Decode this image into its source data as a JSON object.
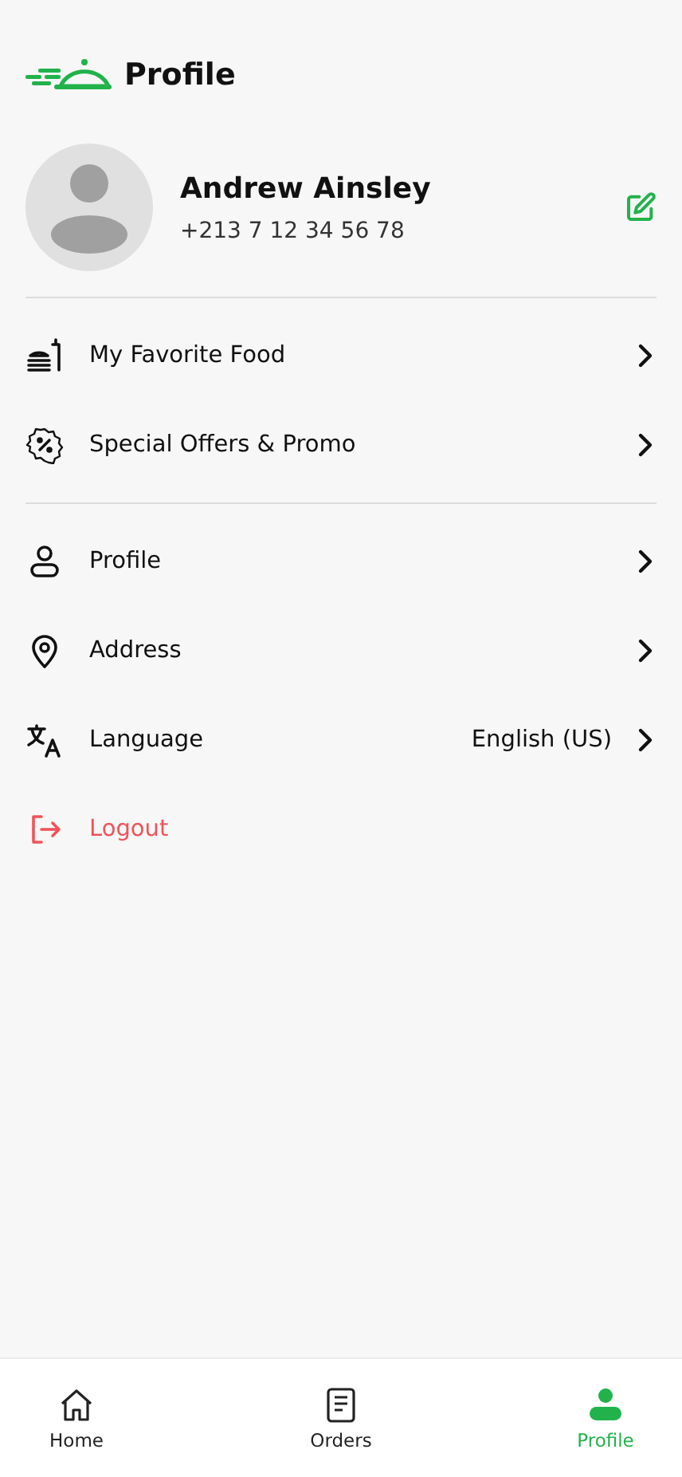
{
  "header": {
    "title": "Profile"
  },
  "user": {
    "name": "Andrew Ainsley",
    "phone": "+213 7 12 34 56 78"
  },
  "menu_sections": [
    {
      "items": [
        {
          "kind": "food",
          "label": "My Favorite Food"
        },
        {
          "kind": "promo",
          "label": "Special Offers & Promo"
        }
      ]
    },
    {
      "items": [
        {
          "kind": "person",
          "label": "Profile"
        },
        {
          "kind": "pin",
          "label": "Address"
        },
        {
          "kind": "translate",
          "label": "Language",
          "value": "English (US)"
        },
        {
          "kind": "logout",
          "label": "Logout"
        }
      ]
    }
  ],
  "bottom_nav": [
    {
      "kind": "home",
      "label": "Home",
      "selected": false
    },
    {
      "kind": "orders",
      "label": "Orders",
      "selected": false
    },
    {
      "kind": "person",
      "label": "Profile",
      "selected": true
    }
  ]
}
